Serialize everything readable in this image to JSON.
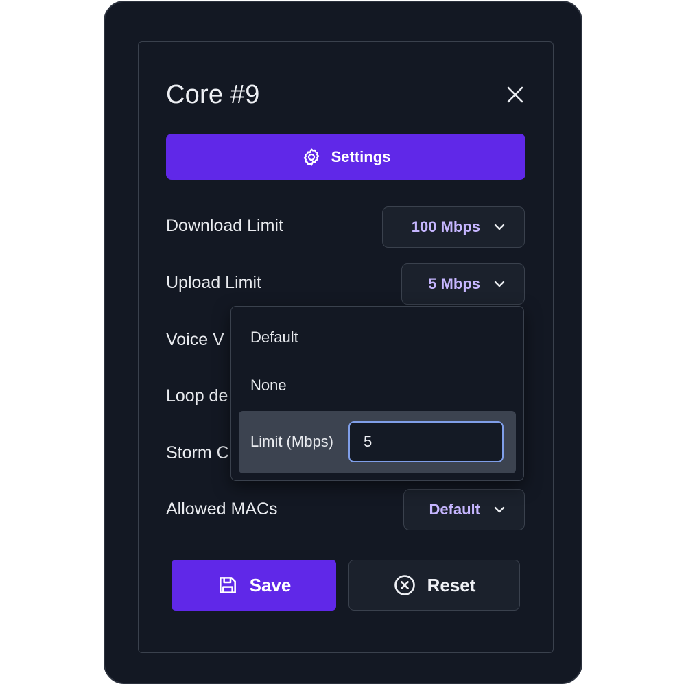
{
  "dialog": {
    "title": "Core #9",
    "settings_label": "Settings"
  },
  "rows": [
    {
      "label": "Download Limit",
      "value": "100 Mbps"
    },
    {
      "label": "Upload Limit",
      "value": "5 Mbps"
    },
    {
      "label": "Voice V"
    },
    {
      "label": "Loop de"
    },
    {
      "label": "Storm C"
    },
    {
      "label": "Allowed MACs",
      "value": "Default"
    }
  ],
  "upload_menu": {
    "options": [
      "Default",
      "None"
    ],
    "limit_label": "Limit (Mbps)",
    "limit_value": "5"
  },
  "footer": {
    "save_label": "Save",
    "reset_label": "Reset"
  },
  "colors": {
    "accent": "#6028e8",
    "dropdown_value": "#c6b6ff",
    "background": "#131823",
    "focus_ring": "#7f9ee8"
  },
  "icons": {
    "close": "close-icon",
    "settings": "gear-icon",
    "dropdown": "chevron-down-icon",
    "save": "floppy-disk-icon",
    "reset": "circle-x-icon"
  }
}
